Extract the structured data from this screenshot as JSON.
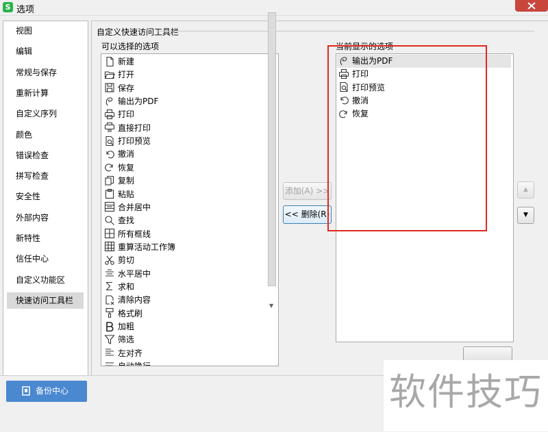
{
  "window": {
    "title": "选项",
    "app_icon_letter": "S"
  },
  "nav": {
    "items": [
      {
        "label": "视图"
      },
      {
        "label": "编辑"
      },
      {
        "label": "常规与保存"
      },
      {
        "label": "重新计算"
      },
      {
        "label": "自定义序列"
      },
      {
        "label": "颜色"
      },
      {
        "label": "错误检查"
      },
      {
        "label": "拼写检查"
      },
      {
        "label": "安全性"
      },
      {
        "label": "外部内容"
      },
      {
        "label": "新特性"
      },
      {
        "label": "信任中心"
      },
      {
        "label": "自定义功能区"
      },
      {
        "label": "快速访问工具栏"
      }
    ],
    "selected": "快速访问工具栏"
  },
  "section": {
    "title": "自定义快速访问工具栏",
    "available_label": "可以选择的选项",
    "current_label": "当前显示的选项"
  },
  "available_items": [
    {
      "label": "新建",
      "icon": "new-doc-icon"
    },
    {
      "label": "打开",
      "icon": "folder-icon"
    },
    {
      "label": "保存",
      "icon": "save-icon"
    },
    {
      "label": "输出为PDF",
      "icon": "pdf-icon"
    },
    {
      "label": "打印",
      "icon": "printer-icon"
    },
    {
      "label": "直接打印",
      "icon": "direct-print-icon"
    },
    {
      "label": "打印预览",
      "icon": "print-preview-icon"
    },
    {
      "label": "撤消",
      "icon": "undo-icon"
    },
    {
      "label": "恢复",
      "icon": "redo-icon"
    },
    {
      "label": "复制",
      "icon": "copy-icon"
    },
    {
      "label": "粘贴",
      "icon": "paste-icon"
    },
    {
      "label": "合并居中",
      "icon": "merge-center-icon"
    },
    {
      "label": "查找",
      "icon": "find-icon"
    },
    {
      "label": "所有框线",
      "icon": "all-borders-icon"
    },
    {
      "label": "重算活动工作簿",
      "icon": "recalc-icon"
    },
    {
      "label": "剪切",
      "icon": "cut-icon"
    },
    {
      "label": "水平居中",
      "icon": "align-center-icon"
    },
    {
      "label": "求和",
      "icon": "sum-icon"
    },
    {
      "label": "清除内容",
      "icon": "clear-icon"
    },
    {
      "label": "格式刷",
      "icon": "format-painter-icon"
    },
    {
      "label": "加粗",
      "icon": "bold-icon"
    },
    {
      "label": "筛选",
      "icon": "filter-icon"
    },
    {
      "label": "左对齐",
      "icon": "align-left-icon"
    },
    {
      "label": "自动换行",
      "icon": "wrap-icon"
    }
  ],
  "current_items": [
    {
      "label": "输出为PDF",
      "icon": "pdf-icon"
    },
    {
      "label": "打印",
      "icon": "printer-icon"
    },
    {
      "label": "打印预览",
      "icon": "print-preview-icon"
    },
    {
      "label": "撤消",
      "icon": "undo-icon"
    },
    {
      "label": "恢复",
      "icon": "redo-icon"
    }
  ],
  "buttons": {
    "add": "添加(A) >>",
    "delete": "<< 删除(R)",
    "up": "▲",
    "down": "▼",
    "backup": "备份中心"
  },
  "watermark": "软件技巧",
  "colors": {
    "highlight_box": "#e0281c",
    "backup_button": "#4a88cf",
    "close_button": "#c9463d"
  }
}
